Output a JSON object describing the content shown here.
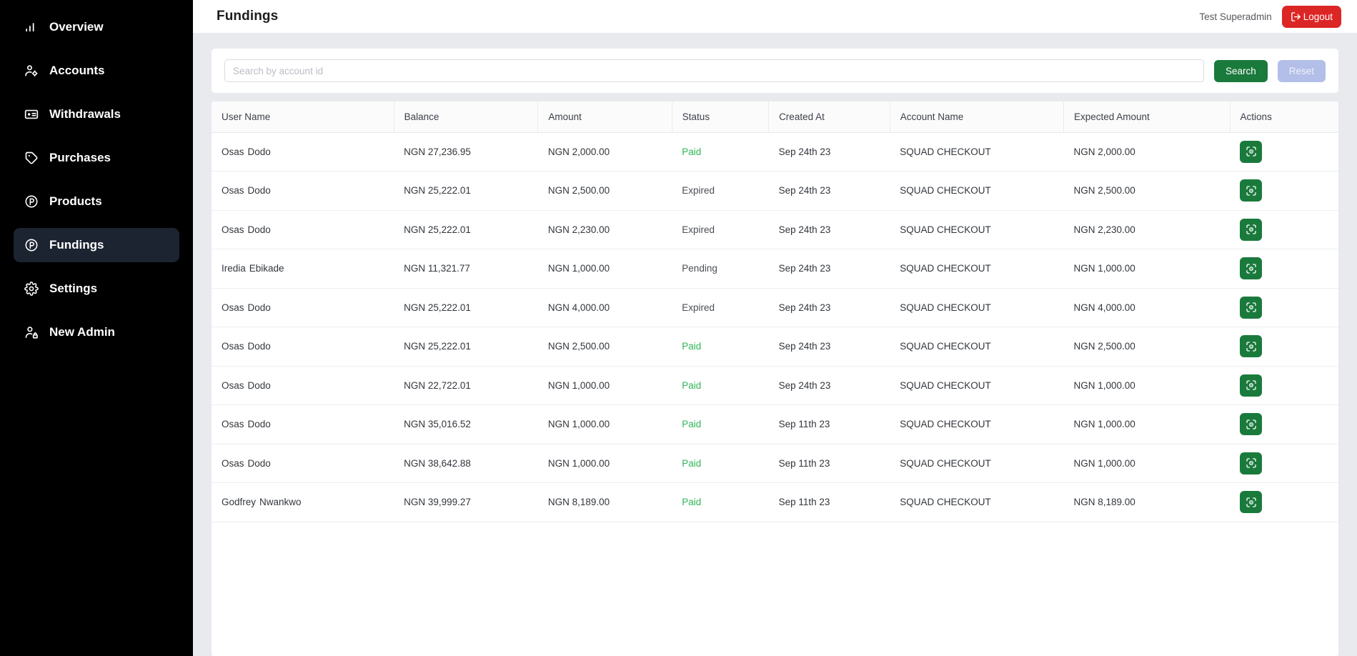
{
  "sidebar": {
    "items": [
      {
        "label": "Overview",
        "icon": "bar-chart-icon",
        "active": false
      },
      {
        "label": "Accounts",
        "icon": "user-cog-icon",
        "active": false
      },
      {
        "label": "Withdrawals",
        "icon": "card-icon",
        "active": false
      },
      {
        "label": "Purchases",
        "icon": "tag-icon",
        "active": false
      },
      {
        "label": "Products",
        "icon": "p-circle-icon",
        "active": false
      },
      {
        "label": "Fundings",
        "icon": "p-circle-icon",
        "active": true
      },
      {
        "label": "Settings",
        "icon": "gear-icon",
        "active": false
      },
      {
        "label": "New Admin",
        "icon": "user-lock-icon",
        "active": false
      }
    ]
  },
  "header": {
    "title": "Fundings",
    "user": "Test  Superadmin",
    "logout_label": "Logout"
  },
  "search": {
    "placeholder": "Search by account id",
    "value": "",
    "search_label": "Search",
    "reset_label": "Reset"
  },
  "colors": {
    "sidebar_bg": "#000000",
    "sidebar_active_bg": "#1b2430",
    "page_bg": "#e8eaee",
    "accent_green": "#1a7a3c",
    "status_paid": "#2fb457",
    "logout_red": "#dc2626",
    "reset_lavender": "#b3bfe8"
  },
  "table": {
    "columns": [
      "User Name",
      "Balance",
      "Amount",
      "Status",
      "Created At",
      "Account Name",
      "Expected Amount",
      "Actions"
    ],
    "action_icon": "scan-view-icon",
    "rows": [
      {
        "first_name": "Osas",
        "last_name": "Dodo",
        "balance": "NGN 27,236.95",
        "amount": "NGN 2,000.00",
        "status": "Paid",
        "created_at": "Sep 24th 23",
        "account_name": "SQUAD CHECKOUT",
        "expected_amount": "NGN 2,000.00"
      },
      {
        "first_name": "Osas",
        "last_name": "Dodo",
        "balance": "NGN 25,222.01",
        "amount": "NGN 2,500.00",
        "status": "Expired",
        "created_at": "Sep 24th 23",
        "account_name": "SQUAD CHECKOUT",
        "expected_amount": "NGN 2,500.00"
      },
      {
        "first_name": "Osas",
        "last_name": "Dodo",
        "balance": "NGN 25,222.01",
        "amount": "NGN 2,230.00",
        "status": "Expired",
        "created_at": "Sep 24th 23",
        "account_name": "SQUAD CHECKOUT",
        "expected_amount": "NGN 2,230.00"
      },
      {
        "first_name": "Iredia",
        "last_name": "Ebikade",
        "balance": "NGN 11,321.77",
        "amount": "NGN 1,000.00",
        "status": "Pending",
        "created_at": "Sep 24th 23",
        "account_name": "SQUAD CHECKOUT",
        "expected_amount": "NGN 1,000.00"
      },
      {
        "first_name": "Osas",
        "last_name": "Dodo",
        "balance": "NGN 25,222.01",
        "amount": "NGN 4,000.00",
        "status": "Expired",
        "created_at": "Sep 24th 23",
        "account_name": "SQUAD CHECKOUT",
        "expected_amount": "NGN 4,000.00"
      },
      {
        "first_name": "Osas",
        "last_name": "Dodo",
        "balance": "NGN 25,222.01",
        "amount": "NGN 2,500.00",
        "status": "Paid",
        "created_at": "Sep 24th 23",
        "account_name": "SQUAD CHECKOUT",
        "expected_amount": "NGN 2,500.00"
      },
      {
        "first_name": "Osas",
        "last_name": "Dodo",
        "balance": "NGN 22,722.01",
        "amount": "NGN 1,000.00",
        "status": "Paid",
        "created_at": "Sep 24th 23",
        "account_name": "SQUAD CHECKOUT",
        "expected_amount": "NGN 1,000.00"
      },
      {
        "first_name": "Osas",
        "last_name": "Dodo",
        "balance": "NGN 35,016.52",
        "amount": "NGN 1,000.00",
        "status": "Paid",
        "created_at": "Sep 11th 23",
        "account_name": "SQUAD CHECKOUT",
        "expected_amount": "NGN 1,000.00"
      },
      {
        "first_name": "Osas",
        "last_name": "Dodo",
        "balance": "NGN 38,642.88",
        "amount": "NGN 1,000.00",
        "status": "Paid",
        "created_at": "Sep 11th 23",
        "account_name": "SQUAD CHECKOUT",
        "expected_amount": "NGN 1,000.00"
      },
      {
        "first_name": "Godfrey",
        "last_name": "Nwankwo",
        "balance": "NGN 39,999.27",
        "amount": "NGN 8,189.00",
        "status": "Paid",
        "created_at": "Sep 11th 23",
        "account_name": "SQUAD CHECKOUT",
        "expected_amount": "NGN 8,189.00"
      }
    ]
  }
}
